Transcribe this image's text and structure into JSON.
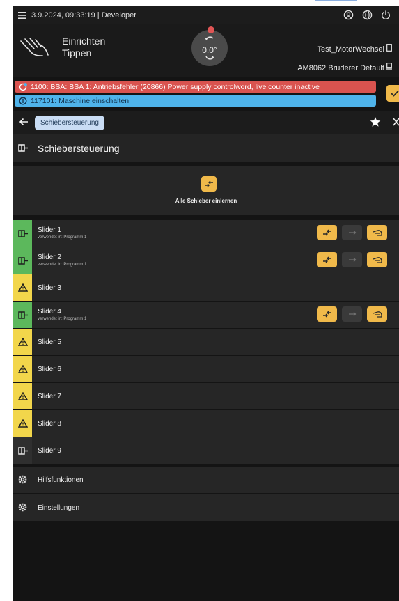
{
  "topbar": {
    "title": "3.9.2024, 09:33:19 | Developer"
  },
  "header": {
    "mode_line1": "Einrichten",
    "mode_line2": "Tippen",
    "dial_value": "0.0°",
    "program_name": "Test_MotorWechsel",
    "machine_name": "AM8062 Bruderer Default"
  },
  "alarms": {
    "error_text": "1100: BSA: BSA 1: Antriebsfehler (20866) Power supply controlword, live counter inactive",
    "info_text": "117101: Maschine einschalten"
  },
  "nav": {
    "breadcrumb": "Schiebersteuerung"
  },
  "section": {
    "title": "Schiebersteuerung"
  },
  "teach_all": {
    "label": "Alle Schieber einlernen"
  },
  "sliders": [
    {
      "name": "Slider 1",
      "used_in": "verwendet in: Programm 1",
      "status": "ok"
    },
    {
      "name": "Slider 2",
      "used_in": "verwendet in: Programm 1",
      "status": "ok"
    },
    {
      "name": "Slider 3",
      "used_in": "",
      "status": "warning"
    },
    {
      "name": "Slider 4",
      "used_in": "verwendet in: Programm 1",
      "status": "ok"
    },
    {
      "name": "Slider 5",
      "used_in": "",
      "status": "warning"
    },
    {
      "name": "Slider 6",
      "used_in": "",
      "status": "warning"
    },
    {
      "name": "Slider 7",
      "used_in": "",
      "status": "warning"
    },
    {
      "name": "Slider 8",
      "used_in": "",
      "status": "warning"
    },
    {
      "name": "Slider 9",
      "used_in": "",
      "status": "inactive"
    }
  ],
  "extras": [
    {
      "label": "Hilfsfunktionen",
      "icon": "gear-icon"
    },
    {
      "label": "Einstellungen",
      "icon": "gear-icon"
    }
  ],
  "colors": {
    "accent": "#f0b94a",
    "ok": "#5cb85c",
    "warning": "#f2d64b",
    "error": "#d9534f",
    "info": "#4fb3ea"
  }
}
